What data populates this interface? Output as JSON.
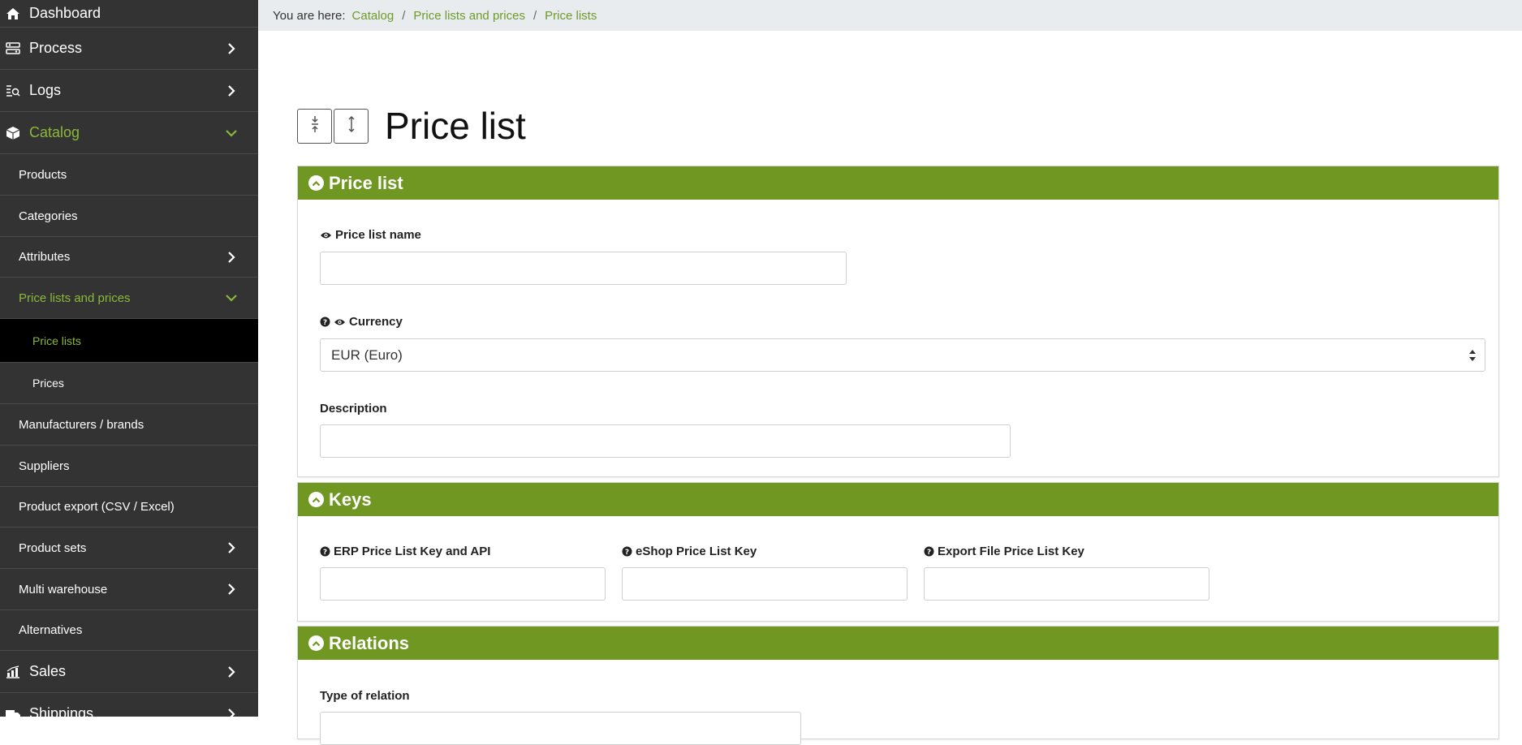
{
  "sidebar": {
    "items": [
      {
        "label": "Dashboard"
      },
      {
        "label": "Process"
      },
      {
        "label": "Logs"
      },
      {
        "label": "Catalog"
      },
      {
        "label": "Products"
      },
      {
        "label": "Categories"
      },
      {
        "label": "Attributes"
      },
      {
        "label": "Price lists and prices"
      },
      {
        "label": "Price lists"
      },
      {
        "label": "Prices"
      },
      {
        "label": "Manufacturers / brands"
      },
      {
        "label": "Suppliers"
      },
      {
        "label": "Product export (CSV / Excel)"
      },
      {
        "label": "Product sets"
      },
      {
        "label": "Multi warehouse"
      },
      {
        "label": "Alternatives"
      },
      {
        "label": "Sales"
      },
      {
        "label": "Shippings"
      }
    ]
  },
  "breadcrumb": {
    "prefix": "You are here:",
    "items": [
      "Catalog",
      "Price lists and prices",
      "Price lists"
    ],
    "separator": "/"
  },
  "page": {
    "title": "Price list"
  },
  "sections": {
    "price_list": {
      "header": "Price list",
      "name_label": "Price list name",
      "name_value": "",
      "currency_label": "Currency",
      "currency_value": "EUR (Euro)",
      "description_label": "Description",
      "description_value": ""
    },
    "keys": {
      "header": "Keys",
      "erp_label": "ERP Price List Key and API",
      "eshop_label": "eShop Price List Key",
      "export_label": "Export File Price List Key"
    },
    "relations": {
      "header": "Relations",
      "type_label": "Type of relation"
    }
  },
  "colors": {
    "sidebar_bg": "#333333",
    "accent_green": "#6f9722",
    "link_green": "#8cb83a",
    "breadcrumb_bg": "#e9ecef"
  }
}
